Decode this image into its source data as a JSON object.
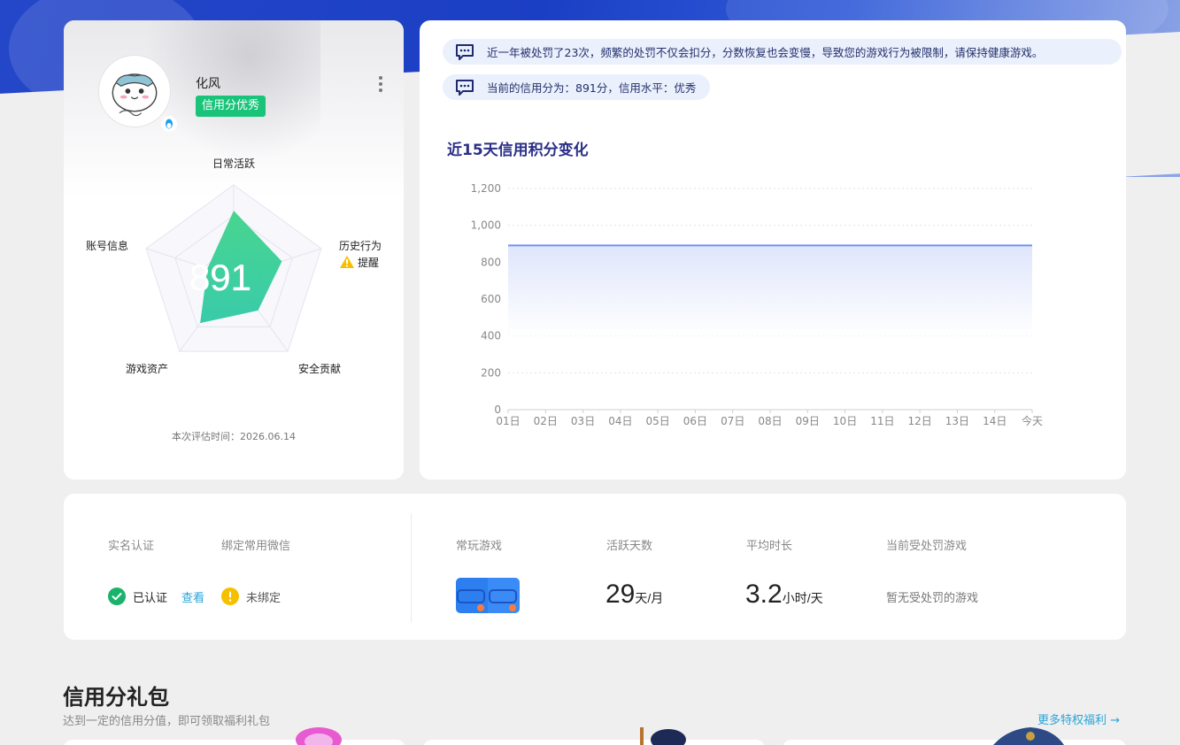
{
  "profile": {
    "username": "化风",
    "credit_tag": "信用分优秀",
    "score": "891",
    "eval_time": "本次评估时间：2026.06.14",
    "radar_axes": [
      "日常活跃",
      "历史行为",
      "安全贡献",
      "游戏资产",
      "账号信息"
    ],
    "radar_values": [
      0.72,
      0.55,
      0.45,
      0.62,
      0.3
    ],
    "history_warning": "提醒"
  },
  "notices": {
    "notice1": "近一年被处罚了23次，频繁的处罚不仅会扣分，分数恢复也会变慢，导致您的游戏行为被限制，请保持健康游戏。",
    "notice2": "当前的信用分为：891分，信用水平：优秀"
  },
  "chart_data": {
    "type": "area",
    "title": "近15天信用积分变化",
    "categories": [
      "01日",
      "02日",
      "03日",
      "04日",
      "05日",
      "06日",
      "07日",
      "08日",
      "09日",
      "10日",
      "11日",
      "12日",
      "13日",
      "14日",
      "今天"
    ],
    "values": [
      891,
      891,
      891,
      891,
      891,
      891,
      891,
      891,
      891,
      891,
      891,
      891,
      891,
      891,
      891
    ],
    "ylim": [
      0,
      1200
    ],
    "yticks": [
      "0",
      "200",
      "400",
      "600",
      "800",
      "1,000",
      "1,200"
    ],
    "grid": true,
    "line_color": "#6f95ee"
  },
  "stats": {
    "realname_label": "实名认证",
    "wechat_label": "绑定常用微信",
    "realname_status": "已认证",
    "view_link": "查看",
    "wechat_status": "未绑定",
    "frequent_game_label": "常玩游戏",
    "active_days_label": "活跃天数",
    "active_days_value": "29",
    "active_days_unit": "天/月",
    "avg_time_label": "平均时长",
    "avg_time_value": "3.2",
    "avg_time_unit": "小时/天",
    "penalty_label": "当前受处罚游戏",
    "penalty_value": "暂无受处罚的游戏"
  },
  "gifts": {
    "title": "信用分礼包",
    "subtitle": "达到一定的信用分值，即可领取福利礼包",
    "more": "更多特权福利 →"
  },
  "colors": {
    "accent_green": "#19c47a",
    "link_blue": "#2aa4d9",
    "title_navy": "#2b2f88",
    "warning_yellow": "#f5c000"
  }
}
